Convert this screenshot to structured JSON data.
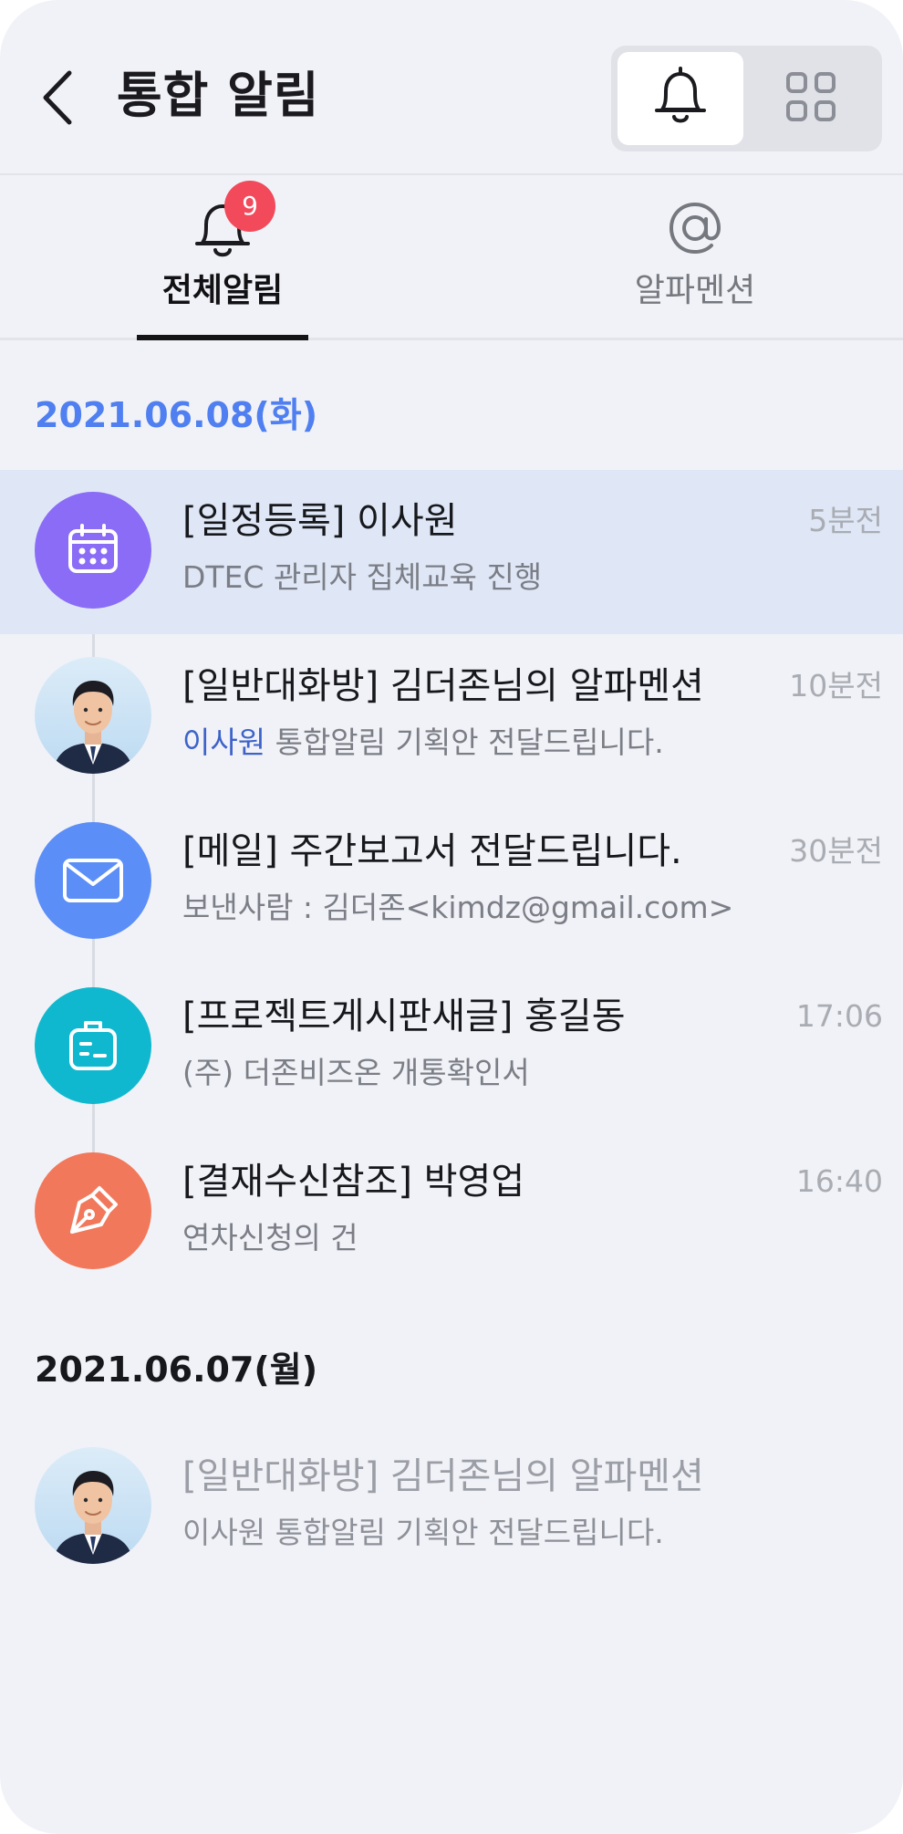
{
  "header": {
    "title": "통합 알림",
    "back_icon": "chevron-left-icon",
    "view_toggle": [
      {
        "icon": "bell-icon",
        "active": true
      },
      {
        "icon": "grid-icon",
        "active": false
      }
    ]
  },
  "tabs": [
    {
      "label": "전체알림",
      "icon": "bell-icon",
      "badge": "9",
      "active": true
    },
    {
      "label": "알파멘션",
      "icon": "at-icon",
      "active": false
    }
  ],
  "groups": [
    {
      "date": "2021.06.08(화)",
      "items": [
        {
          "title": "[일정등록] 이사원",
          "subtitle": "DTEC 관리자 집체교육 진행",
          "time": "5분전",
          "icon": "calendar-icon",
          "color": "#8a6cf6",
          "highlighted": true
        },
        {
          "title": "[일반대화방] 김더존님의 알파멘션",
          "mention": "이사원",
          "subtitle": " 통합알림 기획안 전달드립니다.",
          "time": "10분전",
          "icon": "avatar"
        },
        {
          "title": "[메일] 주간보고서 전달드립니다.",
          "subtitle": "보낸사람 : 김더존<kimdz@gmail.com>",
          "time": "30분전",
          "icon": "mail-icon",
          "color": "#5b8ef7"
        },
        {
          "title": "[프로젝트게시판새글] 홍길동",
          "subtitle": "(주) 더존비즈온 개통확인서",
          "time": "17:06",
          "icon": "board-icon",
          "color": "#10b8cf"
        },
        {
          "title": "[결재수신참조] 박영업",
          "subtitle": "연차신청의 건",
          "time": "16:40",
          "icon": "pen-icon",
          "color": "#f2785b"
        }
      ]
    },
    {
      "date": "2021.06.07(월)",
      "items": [
        {
          "title": "[일반대화방] 김더존님의 알파멘션",
          "subtitle": "이사원 통합알림 기획안 전달드립니다.",
          "icon": "avatar",
          "read": true
        }
      ]
    }
  ]
}
